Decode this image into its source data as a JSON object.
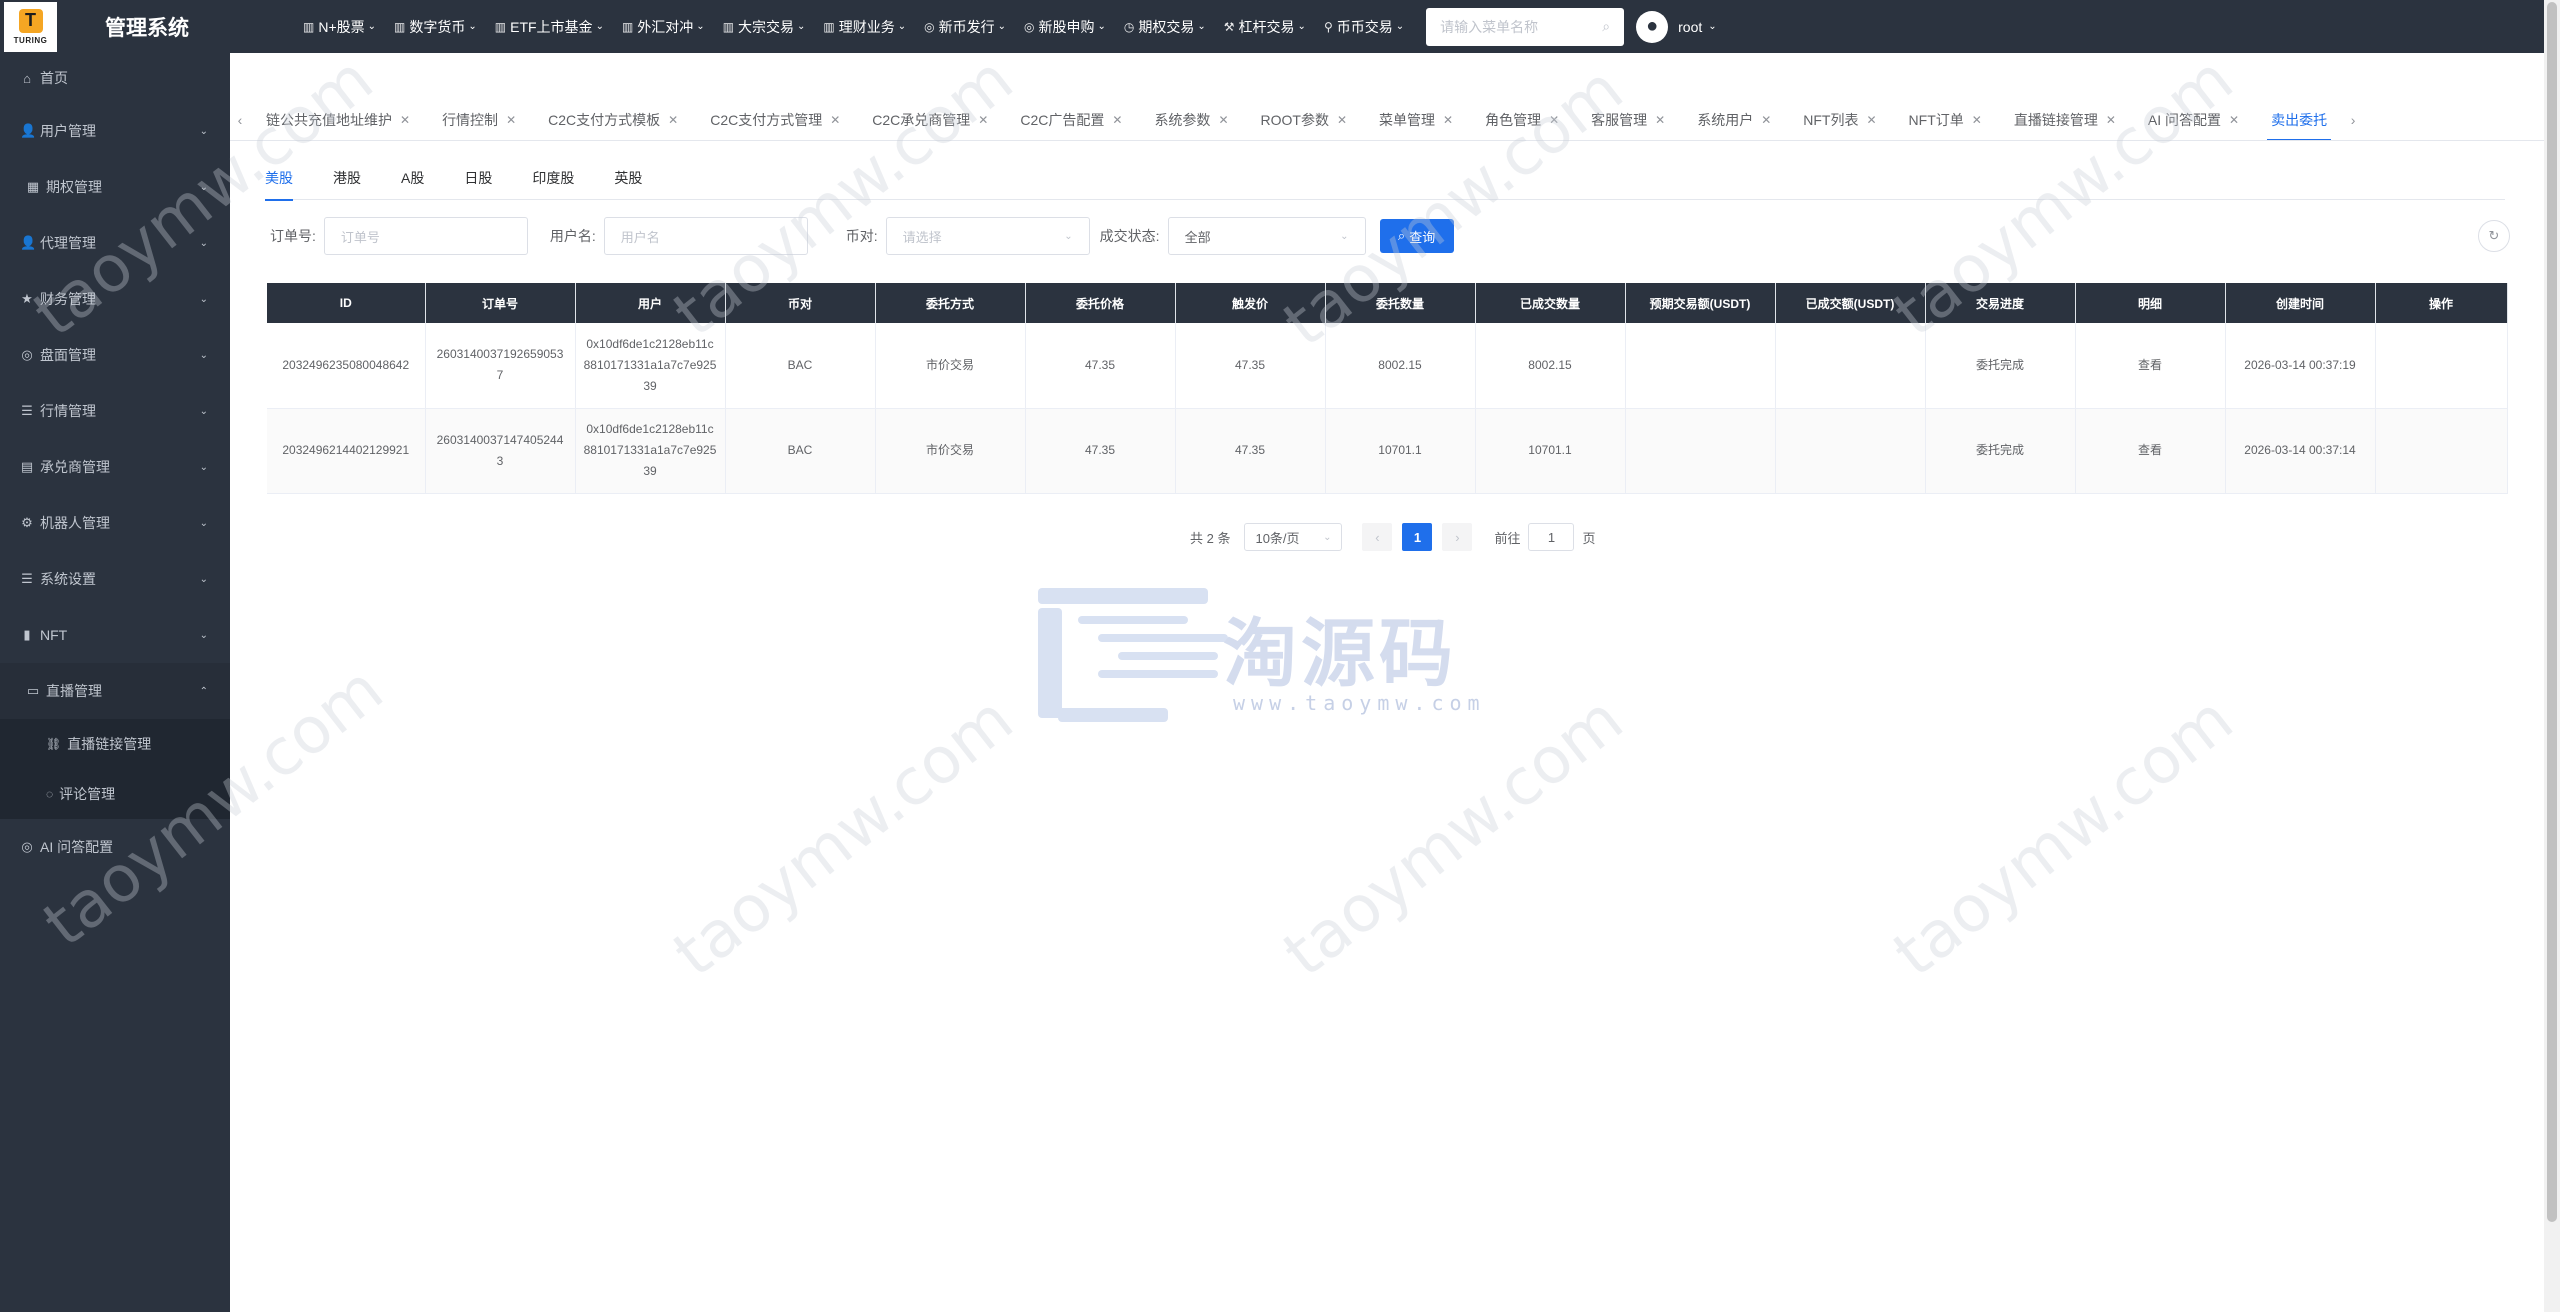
{
  "brand": {
    "logo_letter": "T",
    "logo_text": "TURING",
    "title": "管理系统"
  },
  "topnav": [
    {
      "icon": "▥",
      "label": "N+股票"
    },
    {
      "icon": "▥",
      "label": "数字货币"
    },
    {
      "icon": "▥",
      "label": "ETF上市基金"
    },
    {
      "icon": "▥",
      "label": "外汇对冲"
    },
    {
      "icon": "▥",
      "label": "大宗交易"
    },
    {
      "icon": "▥",
      "label": "理财业务"
    },
    {
      "icon": "◎",
      "label": "新币发行"
    },
    {
      "icon": "◎",
      "label": "新股申购"
    },
    {
      "icon": "◷",
      "label": "期权交易"
    },
    {
      "icon": "⚒",
      "label": "杠杆交易"
    },
    {
      "icon": "⚲",
      "label": "币币交易"
    }
  ],
  "search": {
    "placeholder": "请输入菜单名称"
  },
  "user": {
    "name": "root"
  },
  "sidebar": {
    "items": [
      {
        "icon": "⌂",
        "label": "首页"
      },
      {
        "icon": "👤",
        "label": "用户管理"
      },
      {
        "icon": "▦",
        "label": "期权管理"
      },
      {
        "icon": "👤",
        "label": "代理管理"
      },
      {
        "icon": "★",
        "label": "财务管理"
      },
      {
        "icon": "◎",
        "label": "盘面管理"
      },
      {
        "icon": "☰",
        "label": "行情管理"
      },
      {
        "icon": "▤",
        "label": "承兑商管理"
      },
      {
        "icon": "⚙",
        "label": "机器人管理"
      },
      {
        "icon": "☰",
        "label": "系统设置"
      },
      {
        "icon": "▮",
        "label": "NFT"
      },
      {
        "icon": "▭",
        "label": "直播管理"
      }
    ],
    "sub_items": [
      {
        "icon": "⛓",
        "label": "直播链接管理"
      },
      {
        "icon": "◌",
        "label": "评论管理"
      }
    ],
    "last_item": {
      "icon": "◎",
      "label": "AI 问答配置"
    }
  },
  "tabs": [
    "链公共充值地址维护",
    "行情控制",
    "C2C支付方式模板",
    "C2C支付方式管理",
    "C2C承兑商管理",
    "C2C广告配置",
    "系统参数",
    "ROOT参数",
    "菜单管理",
    "角色管理",
    "客服管理",
    "系统用户",
    "NFT列表",
    "NFT订单",
    "直播链接管理",
    "AI 问答配置",
    "卖出委托"
  ],
  "market_tabs": [
    "美股",
    "港股",
    "A股",
    "日股",
    "印度股",
    "英股"
  ],
  "filters": {
    "order_label": "订单号:",
    "order_placeholder": "订单号",
    "user_label": "用户名:",
    "user_placeholder": "用户名",
    "coin_label": "币对:",
    "coin_placeholder": "请选择",
    "status_label": "成交状态:",
    "status_value": "全部",
    "search_button": "查询"
  },
  "table": {
    "headers": [
      "ID",
      "订单号",
      "用户",
      "币对",
      "委托方式",
      "委托价格",
      "触发价",
      "委托数量",
      "已成交数量",
      "预期交易额(USDT)",
      "已成交额(USDT)",
      "交易进度",
      "明细",
      "创建时间",
      "操作"
    ],
    "rows": [
      [
        "2032496235080048642",
        "26031400371926590537",
        "0x10df6de1c2128eb11c8810171331a1a7c7e92539",
        "BAC",
        "市价交易",
        "47.35",
        "47.35",
        "8002.15",
        "8002.15",
        "",
        "",
        "委托完成",
        "查看",
        "2026-03-14 00:37:19",
        ""
      ],
      [
        "2032496214402129921",
        "26031400371474052443",
        "0x10df6de1c2128eb11c8810171331a1a7c7e92539",
        "BAC",
        "市价交易",
        "47.35",
        "47.35",
        "10701.1",
        "10701.1",
        "",
        "",
        "委托完成",
        "查看",
        "2026-03-14 00:37:14",
        ""
      ]
    ]
  },
  "pager": {
    "total": "共 2 条",
    "page_size": "10条/页",
    "current": "1",
    "goto": "前往",
    "goto_value": "1",
    "page_unit": "页"
  },
  "watermark": {
    "text": "淘源码",
    "url": "www.taoymw.com",
    "diag": "taoymw.com"
  }
}
